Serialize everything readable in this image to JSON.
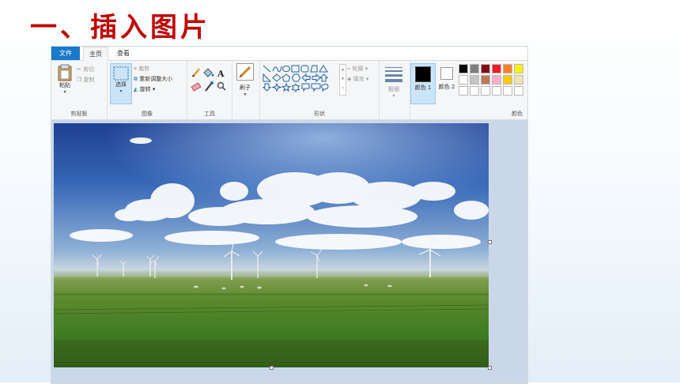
{
  "slide": {
    "title": "一、插入图片"
  },
  "menubar": {
    "file": "文件",
    "home": "主页",
    "view": "查看"
  },
  "clipboard": {
    "paste": "粘贴",
    "cut": "剪切",
    "copy": "复制",
    "group": "剪贴板"
  },
  "image": {
    "select": "选择",
    "crop": "裁剪",
    "resize": "重新调整大小",
    "rotate": "旋转",
    "group": "图像"
  },
  "tools": {
    "group": "工具"
  },
  "brushes": {
    "label": "刷子"
  },
  "shapes": {
    "outline": "轮廓",
    "fill": "填充",
    "group": "形状"
  },
  "size": {
    "label": "粗细"
  },
  "colors": {
    "color1": "颜色 1",
    "color2": "颜色 2",
    "group": "颜色",
    "palette": [
      "#000000",
      "#7f7f7f",
      "#880015",
      "#ed1c24",
      "#ff7f27",
      "#fff200",
      "#ffffff",
      "#c3c3c3",
      "#b97a57",
      "#ffaec9",
      "#ffc90e",
      "#efe4b0"
    ]
  }
}
